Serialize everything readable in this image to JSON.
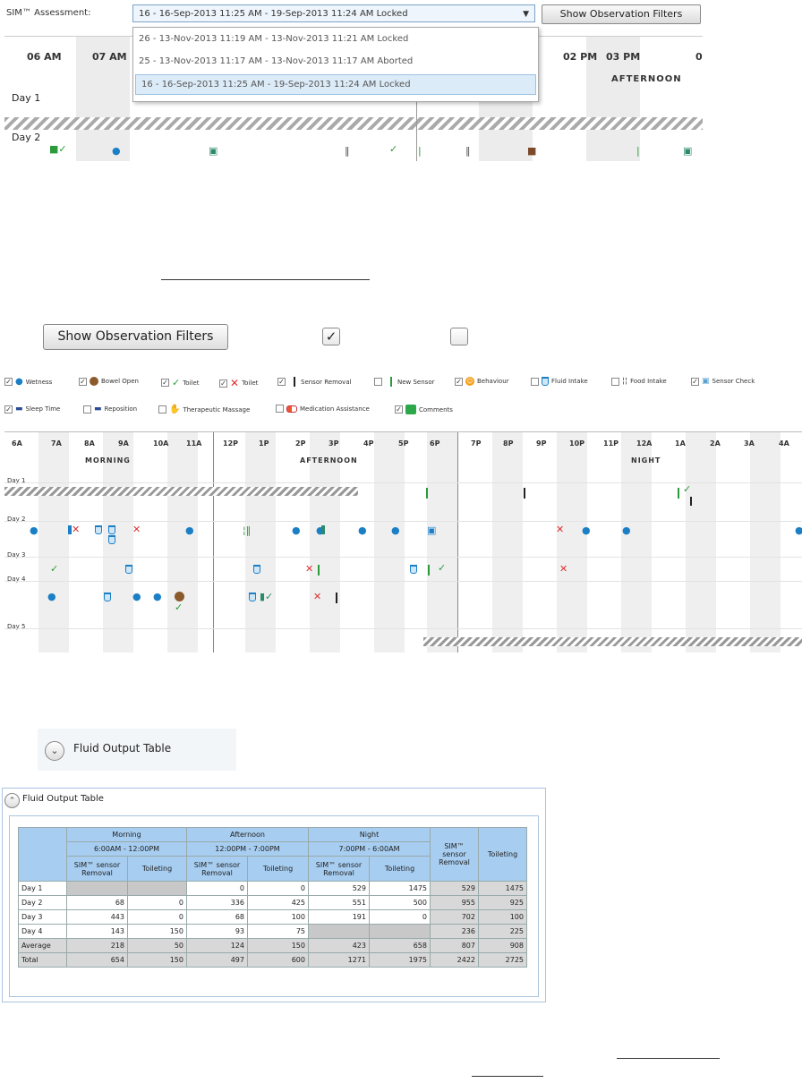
{
  "top_panel": {
    "assessment_label": "SIM™ Assessment:",
    "assessment_selected": "16 - 16-Sep-2013 11:25 AM - 19-Sep-2013 11:24 AM Locked",
    "filter_button": "Show Observation Filters",
    "dropdown_options": [
      "26 - 13-Nov-2013 11:19 AM - 13-Nov-2013 11:21 AM Locked",
      "25 - 13-Nov-2013 11:17 AM - 13-Nov-2013 11:17 AM Aborted",
      "16 - 16-Sep-2013 11:25 AM - 19-Sep-2013 11:24 AM Locked"
    ],
    "hours_left": [
      "06 AM",
      "07 AM"
    ],
    "hours_right": [
      "02 PM",
      "03 PM",
      "0"
    ],
    "segment": "AFTERNOON",
    "days": [
      "Day 1",
      "Day 2"
    ]
  },
  "controls": {
    "filter_button": "Show Observation Filters",
    "checkbox_checked_glyph": "✓"
  },
  "legend": [
    {
      "label": "Wetness",
      "checked": true,
      "icon": "drop-icon"
    },
    {
      "label": "Bowel Open",
      "checked": true,
      "icon": "bowel-icon"
    },
    {
      "label": "Toilet",
      "checked": true,
      "icon": "check-icon"
    },
    {
      "label": "Toilet",
      "checked": true,
      "icon": "cross-icon"
    },
    {
      "label": "Sensor Removal",
      "checked": true,
      "icon": "black-bar-icon"
    },
    {
      "label": "New Sensor",
      "checked": false,
      "icon": "green-bar-icon"
    },
    {
      "label": "Behaviour",
      "checked": true,
      "icon": "behaviour-icon"
    },
    {
      "label": "Fluid Intake",
      "checked": false,
      "icon": "cup-icon"
    },
    {
      "label": "Food Intake",
      "checked": false,
      "icon": "fork-knife-icon"
    },
    {
      "label": "Sensor Check",
      "checked": true,
      "icon": "sensor-check-icon"
    },
    {
      "label": "Sleep Time",
      "checked": true,
      "icon": "bed-icon"
    },
    {
      "label": "Reposition",
      "checked": false,
      "icon": "reposition-icon"
    },
    {
      "label": "Therapeutic Massage",
      "checked": false,
      "icon": "hand-icon"
    },
    {
      "label": "Medication Assistance",
      "checked": false,
      "icon": "pill-icon"
    },
    {
      "label": "Comments",
      "checked": true,
      "icon": "comment-icon"
    }
  ],
  "grid": {
    "hours": [
      "6A",
      "7A",
      "8A",
      "9A",
      "10A",
      "11A",
      "12P",
      "1P",
      "2P",
      "3P",
      "4P",
      "5P",
      "6P",
      "7P",
      "8P",
      "9P",
      "10P",
      "11P",
      "12A",
      "1A",
      "2A",
      "3A",
      "4A"
    ],
    "segments": [
      "MORNING",
      "AFTERNOON",
      "NIGHT"
    ],
    "days": [
      "Day 1",
      "Day 2",
      "Day 3",
      "Day 4",
      "Day 5"
    ]
  },
  "fluid_output": {
    "collapsed_title": "Fluid Output Table",
    "title": "Fluid Output Table",
    "periods": [
      {
        "name": "Morning",
        "range": "6:00AM - 12:00PM"
      },
      {
        "name": "Afternoon",
        "range": "12:00PM - 7:00PM"
      },
      {
        "name": "Night",
        "range": "7:00PM - 6:00AM"
      }
    ],
    "sub_headers": [
      "SIM™ sensor Removal",
      "Toileting"
    ],
    "total_headers": [
      "SIM™ sensor Removal",
      "Toileting"
    ],
    "rows": [
      {
        "label": "Day 1",
        "cells": [
          "",
          "",
          "0",
          "0",
          "529",
          "1475",
          "529",
          "1475"
        ]
      },
      {
        "label": "Day 2",
        "cells": [
          "68",
          "0",
          "336",
          "425",
          "551",
          "500",
          "955",
          "925"
        ]
      },
      {
        "label": "Day 3",
        "cells": [
          "443",
          "0",
          "68",
          "100",
          "191",
          "0",
          "702",
          "100"
        ]
      },
      {
        "label": "Day 4",
        "cells": [
          "143",
          "150",
          "93",
          "75",
          "",
          "",
          "236",
          "225"
        ]
      },
      {
        "label": "Average",
        "cells": [
          "218",
          "50",
          "124",
          "150",
          "423",
          "658",
          "807",
          "908"
        ]
      },
      {
        "label": "Total",
        "cells": [
          "654",
          "150",
          "497",
          "600",
          "1271",
          "1975",
          "2422",
          "2725"
        ]
      }
    ]
  }
}
